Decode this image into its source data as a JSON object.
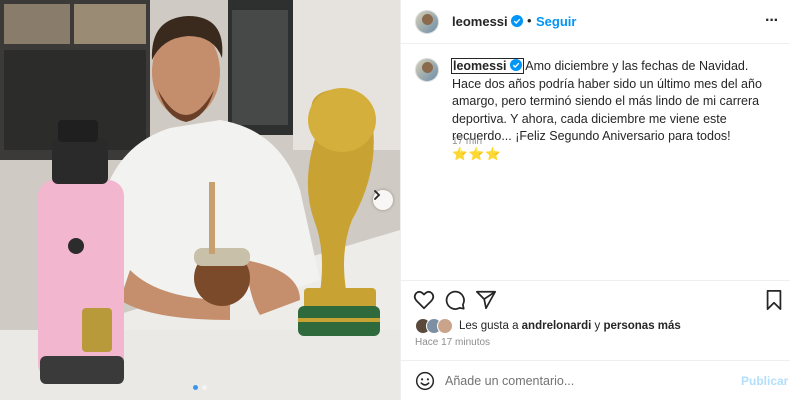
{
  "post": {
    "username": "leomessi",
    "bullet": "•",
    "follow_label": "Seguir",
    "more_label": "···",
    "caption": {
      "username": "leomessi",
      "text": " Amo diciembre y las fechas de Navidad. Hace dos años podría haber sido un último mes del año amargo, pero terminó siendo el más lindo de mi carrera deportiva. Y ahora, cada diciembre me viene este recuerdo... ¡Feliz Segundo Aniversario para todos! ",
      "stars": "⭐⭐⭐",
      "time": "17 min"
    },
    "likes": {
      "prefix": "Les gusta a ",
      "user": "andrelonardi",
      "middle": " y ",
      "others": "personas más"
    },
    "posted_ago": "Hace 17 minutos",
    "comment": {
      "placeholder": "Añade un comentario...",
      "publish_label": "Publicar"
    },
    "carousel": {
      "slide": 1,
      "total": 2
    }
  },
  "icons": {
    "verified": "verified-badge-icon",
    "like": "heart-icon",
    "comment": "comment-bubble-icon",
    "share": "paper-plane-icon",
    "save": "bookmark-icon",
    "emoji": "smiley-icon",
    "next": "chevron-right-icon"
  },
  "colors": {
    "accent": "#0095f6",
    "publish_disabled": "#b2dffc",
    "verified": "#0095f6",
    "muted": "#8e8e8e"
  }
}
